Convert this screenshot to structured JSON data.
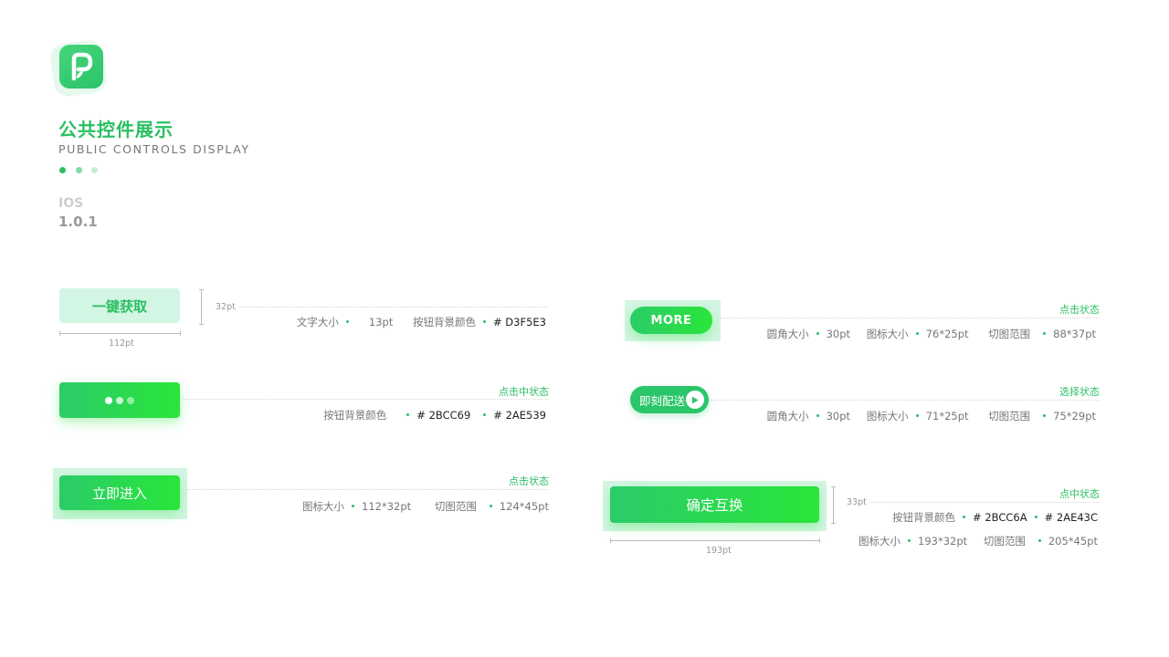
{
  "header": {
    "title_cn": "公共控件展示",
    "title_en": "PUBLIC CONTROLS DISPLAY",
    "platform": "IOS",
    "version": "1.0.1"
  },
  "colors": {
    "accent": "#2BBF63",
    "light_bg": "#D3F5E3",
    "gradient_start": "#2BCC69",
    "gradient_end": "#2AE539"
  },
  "left": {
    "get_button": {
      "label": "一键获取",
      "height_dim": "32pt",
      "width_dim": "112pt",
      "spec_font_label": "文字大小",
      "spec_font_value": "13pt",
      "spec_bg_label": "按钮背景颜色",
      "spec_bg_value": "# D3F5E3"
    },
    "loading_button": {
      "state": "点击中状态",
      "spec_bg_label": "按钮背景颜色",
      "spec_color1": "# 2BCC69",
      "spec_color2": "# 2AE539"
    },
    "enter_button": {
      "label": "立即进入",
      "state": "点击状态",
      "spec_icon_label": "图标大小",
      "spec_icon_value": "112*32pt",
      "spec_cut_label": "切图范围",
      "spec_cut_value": "124*45pt"
    }
  },
  "right": {
    "more_button": {
      "label": "MORE",
      "state": "点击状态",
      "spec_radius_label": "圆角大小",
      "spec_radius_value": "30pt",
      "spec_icon_label": "图标大小",
      "spec_icon_value": "76*25pt",
      "spec_cut_label": "切图范围",
      "spec_cut_value": "88*37pt"
    },
    "delivery_button": {
      "label": "即刻配送",
      "state": "选择状态",
      "spec_radius_label": "圆角大小",
      "spec_radius_value": "30pt",
      "spec_icon_label": "图标大小",
      "spec_icon_value": "71*25pt",
      "spec_cut_label": "切图范围",
      "spec_cut_value": "75*29pt"
    },
    "confirm_button": {
      "label": "确定互换",
      "state": "点中状态",
      "height_dim": "33pt",
      "width_dim": "193pt",
      "spec_bg_label": "按钮背景颜色",
      "spec_color1": "# 2BCC6A",
      "spec_color2": "# 2AE43C",
      "spec_icon_label": "图标大小",
      "spec_icon_value": "193*32pt",
      "spec_cut_label": "切图范围",
      "spec_cut_value": "205*45pt"
    }
  }
}
